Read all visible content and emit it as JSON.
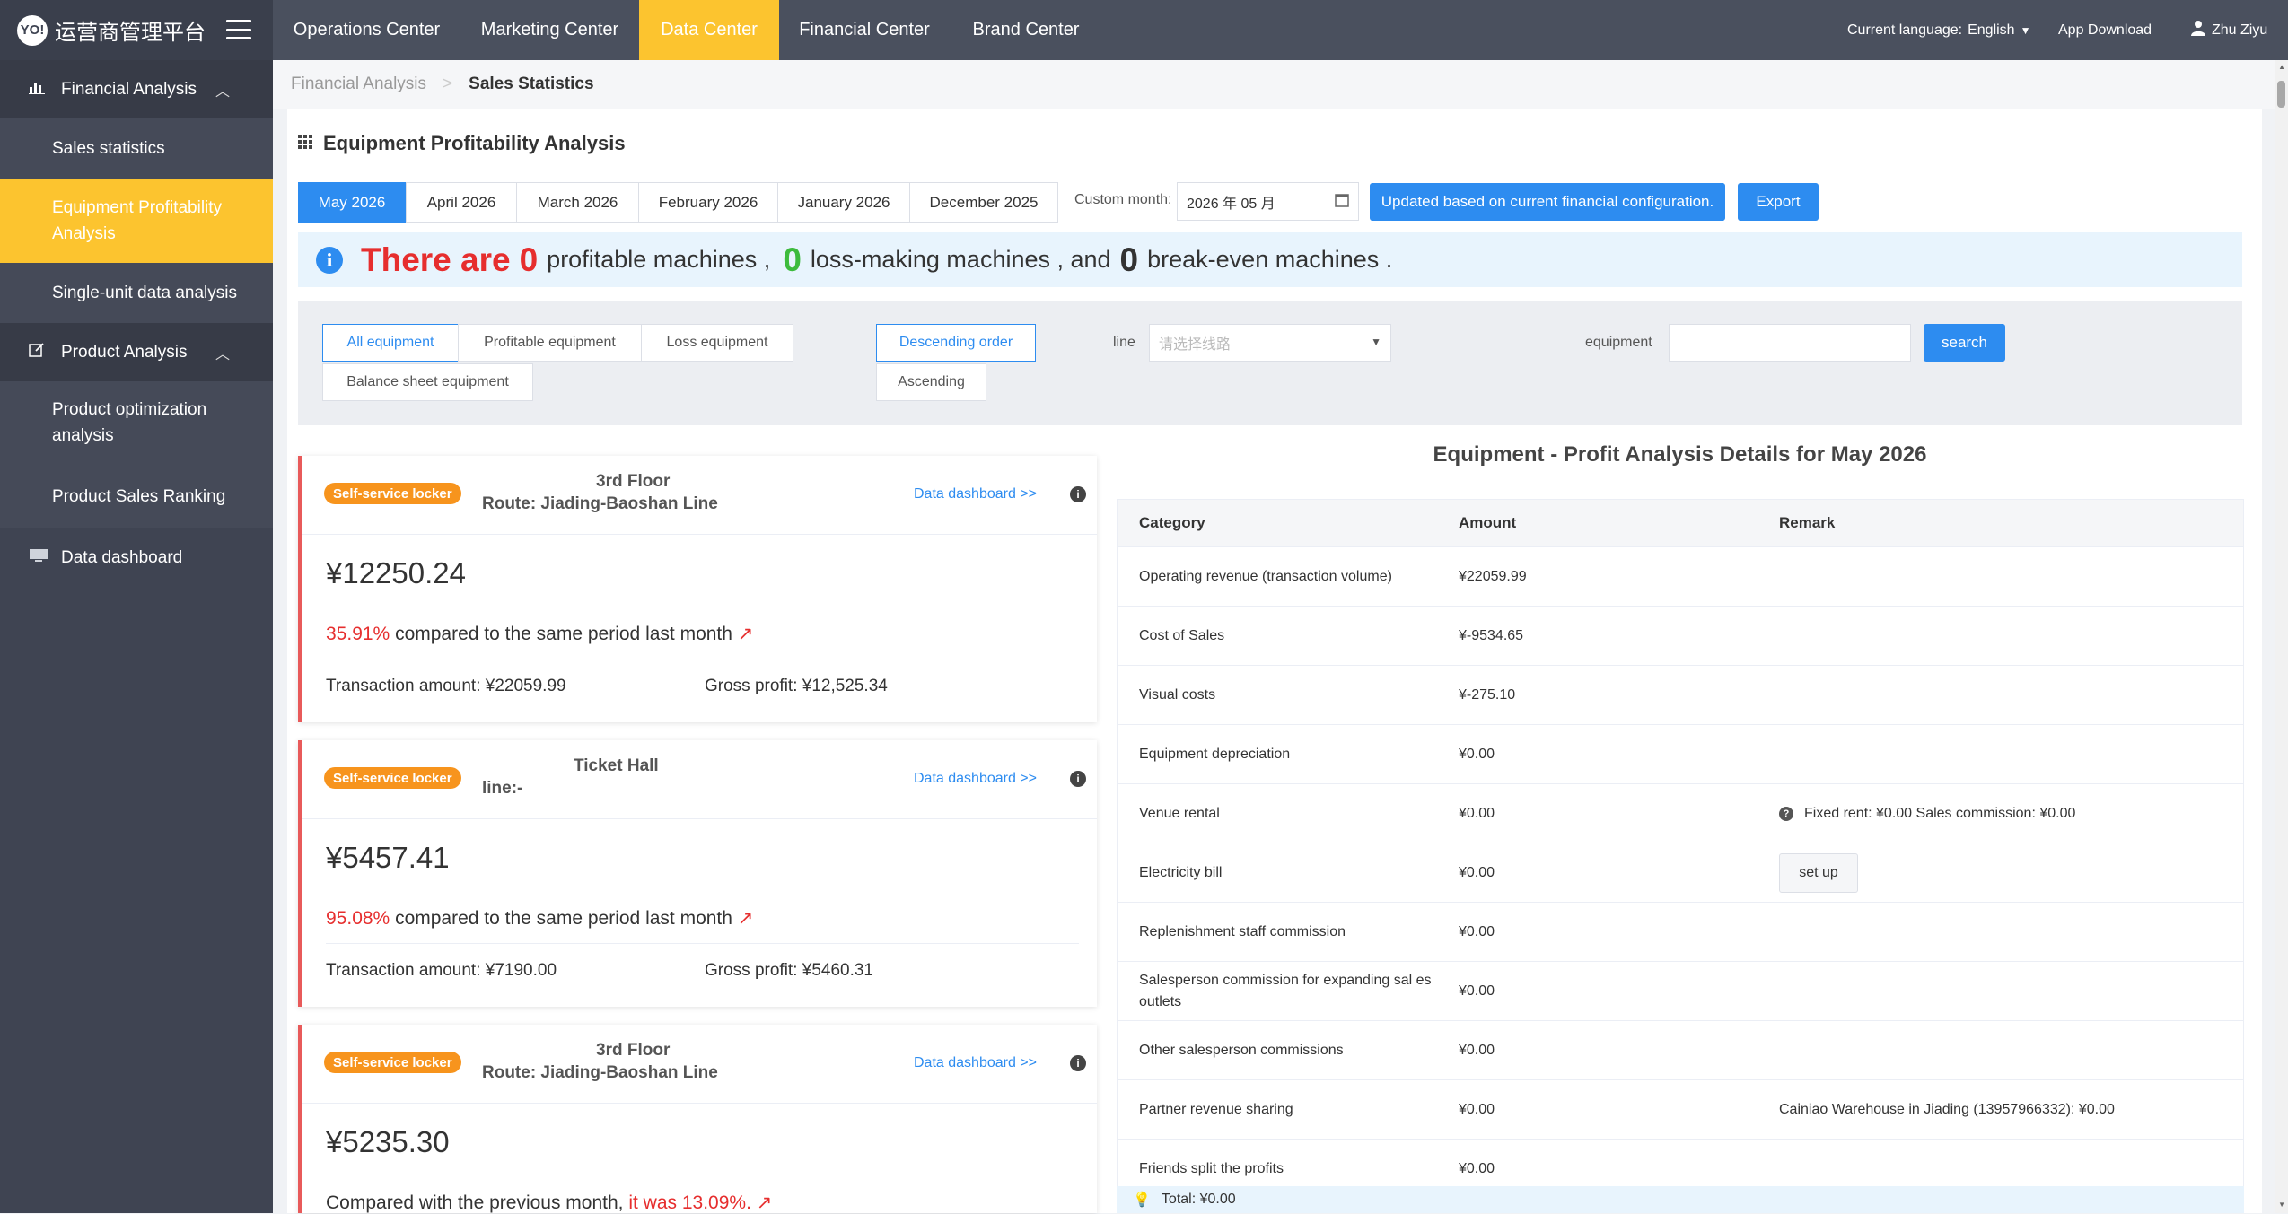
{
  "app": {
    "logo_text": "运营商管理平台",
    "logo_mark": "YO!"
  },
  "sidebar": {
    "group_financial": "Financial Analysis",
    "items_financial": [
      "Sales statistics",
      "Equipment Profitability Analysis",
      "Single-unit data analysis"
    ],
    "group_product": "Product Analysis",
    "items_product": [
      "Product optimization analysis",
      "Product Sales Ranking"
    ],
    "data_dashboard": "Data dashboard"
  },
  "topnav": {
    "items": [
      "Operations Center",
      "Marketing Center",
      "Data Center",
      "Financial Center",
      "Brand Center"
    ],
    "active": "Data Center",
    "current_language_label": "Current language:",
    "language": "English",
    "app_download": "App Download",
    "user": "Zhu Ziyu"
  },
  "breadcrumb": {
    "parent": "Financial Analysis",
    "separator": ">",
    "current": "Sales Statistics"
  },
  "page": {
    "title": "Equipment Profitability Analysis",
    "month_tabs": [
      "May 2026",
      "April 2026",
      "March 2026",
      "February 2026",
      "January 2026",
      "December 2025"
    ],
    "custom_month_label": "Custom month:",
    "custom_month_value": "2026 年 05 月",
    "update_button": "Updated based on current financial configuration.",
    "export_button": "Export"
  },
  "summary": {
    "prefix": "There are",
    "profitable_count": "0",
    "profitable_label": "profitable machines ,",
    "loss_count": "0",
    "loss_label": "loss-making machines , and",
    "breakeven_count": "0",
    "breakeven_label": "break-even machines ."
  },
  "filters": {
    "type_buttons": [
      "All equipment",
      "Profitable equipment",
      "Loss equipment",
      "Balance sheet equipment"
    ],
    "order_buttons": [
      "Descending order",
      "Ascending"
    ],
    "line_label": "line",
    "line_placeholder": "请选择线路",
    "equipment_label": "equipment",
    "equipment_value": "",
    "search_button": "search"
  },
  "cards": [
    {
      "badge": "Self-service locker",
      "title_line1": "3rd Floor",
      "title_line2": "Route: Jiading-Baoshan Line",
      "link": "Data dashboard >>",
      "amount": "¥12250.24",
      "cmp_value": "35.91%",
      "cmp_text": "compared to the same period last month",
      "transaction": "Transaction amount: ¥22059.99",
      "gross": "Gross profit: ¥12,525.34"
    },
    {
      "badge": "Self-service locker",
      "title_line1": "Ticket Hall",
      "title_line2": "line:-",
      "link": "Data dashboard >>",
      "amount": "¥5457.41",
      "cmp_value": "95.08%",
      "cmp_text": "compared to the same period last month",
      "transaction": "Transaction amount: ¥7190.00",
      "gross": "Gross profit: ¥5460.31"
    },
    {
      "badge": "Self-service locker",
      "title_line1": "3rd Floor",
      "title_line2": "Route: Jiading-Baoshan Line",
      "link": "Data dashboard >>",
      "amount": "¥5235.30",
      "cmp_prefix": "Compared with the previous month,",
      "cmp_value": "it was 13.09%."
    }
  ],
  "details": {
    "title": "Equipment - Profit Analysis Details for May 2026",
    "headers": [
      "Category",
      "Amount",
      "Remark"
    ],
    "rows": [
      {
        "category": "Operating revenue (transaction volume)",
        "amount": "¥22059.99",
        "remark": ""
      },
      {
        "category": "Cost of Sales",
        "amount": "¥-9534.65",
        "remark": ""
      },
      {
        "category": "Visual costs",
        "amount": "¥-275.10",
        "remark": ""
      },
      {
        "category": "Equipment depreciation",
        "amount": "¥0.00",
        "remark": ""
      },
      {
        "category": "Venue rental",
        "amount": "¥0.00",
        "remark": "Fixed rent: ¥0.00 Sales commission: ¥0.00"
      },
      {
        "category": "Electricity bill",
        "amount": "¥0.00",
        "remark": "set up"
      },
      {
        "category": "Replenishment staff commission",
        "amount": "¥0.00",
        "remark": ""
      },
      {
        "category": "Salesperson commission for expanding sal es outlets",
        "amount": "¥0.00",
        "remark": ""
      },
      {
        "category": "Other salesperson commissions",
        "amount": "¥0.00",
        "remark": ""
      },
      {
        "category": "Partner revenue sharing",
        "amount": "¥0.00",
        "remark": "Cainiao Warehouse in Jiading (13957966332): ¥0.00"
      },
      {
        "category": "Friends split the profits",
        "amount": "¥0.00",
        "remark": ""
      }
    ],
    "total": "Total: ¥0.00"
  },
  "colors": {
    "accent": "#fcc42f",
    "primary": "#2d8cf0",
    "sidebar": "#3f4452",
    "topbar": "#4a505e",
    "profit_red": "#e62e2e",
    "loss_green": "#3dbb3d"
  }
}
